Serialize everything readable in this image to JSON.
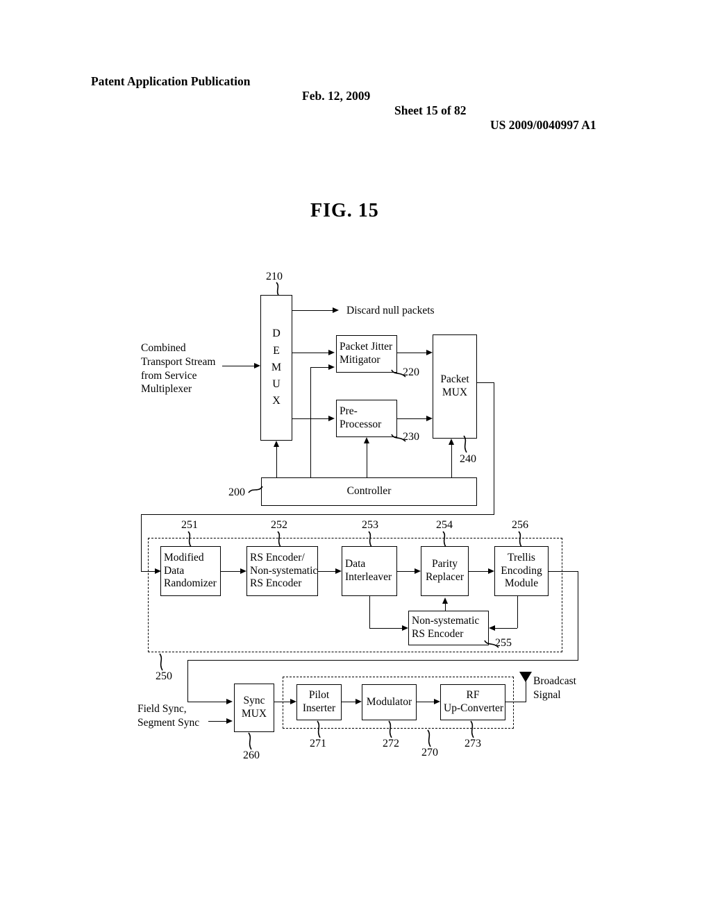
{
  "header": {
    "publication": "Patent Application Publication",
    "date": "Feb. 12, 2009",
    "sheet": "Sheet 15 of 82",
    "patent_number": "US 2009/0040997 A1"
  },
  "figure": {
    "title": "FIG. 15"
  },
  "labels": {
    "input_stream_l1": "Combined",
    "input_stream_l2": "Transport Stream",
    "input_stream_l3": "from Service",
    "input_stream_l4": "Multiplexer",
    "discard": "Discard null packets",
    "field_sync_l1": "Field Sync,",
    "field_sync_l2": "Segment Sync",
    "broadcast_l1": "Broadcast",
    "broadcast_l2": "Signal"
  },
  "blocks": {
    "demux": {
      "letters": [
        "D",
        "E",
        "M",
        "U",
        "X"
      ],
      "ref": "210"
    },
    "packet_jitter_mitigator": {
      "l1": "Packet Jitter",
      "l2": "Mitigator",
      "ref": "220"
    },
    "pre_processor": {
      "l1": "Pre-",
      "l2": "Processor",
      "ref": "230"
    },
    "packet_mux": {
      "l1": "Packet",
      "l2": "MUX",
      "ref": "240"
    },
    "controller": {
      "l1": "Controller",
      "ref": "200"
    },
    "modified_data_randomizer": {
      "l1": "Modified",
      "l2": "Data",
      "l3": "Randomizer",
      "ref": "251"
    },
    "rs_encoder": {
      "l1": "RS Encoder/",
      "l2": "Non-systematic",
      "l3": "RS Encoder",
      "ref": "252"
    },
    "data_interleaver": {
      "l1": "Data",
      "l2": "Interleaver",
      "ref": "253"
    },
    "parity_replacer": {
      "l1": "Parity",
      "l2": "Replacer",
      "ref": "254"
    },
    "trellis_encoding_module": {
      "l1": "Trellis",
      "l2": "Encoding",
      "l3": "Module",
      "ref": "256"
    },
    "non_systematic_rs_encoder": {
      "l1": "Non-systematic",
      "l2": "RS Encoder",
      "ref": "255"
    },
    "exciter_group": {
      "ref": "250"
    },
    "sync_mux": {
      "l1": "Sync",
      "l2": "MUX",
      "ref": "260"
    },
    "pilot_inserter": {
      "l1": "Pilot",
      "l2": "Inserter",
      "ref": "271"
    },
    "modulator": {
      "l1": "Modulator",
      "ref": "272"
    },
    "rf_up_converter": {
      "l1": "RF",
      "l2": "Up-Converter",
      "ref": "273"
    },
    "transmission_unit": {
      "ref": "270"
    }
  }
}
